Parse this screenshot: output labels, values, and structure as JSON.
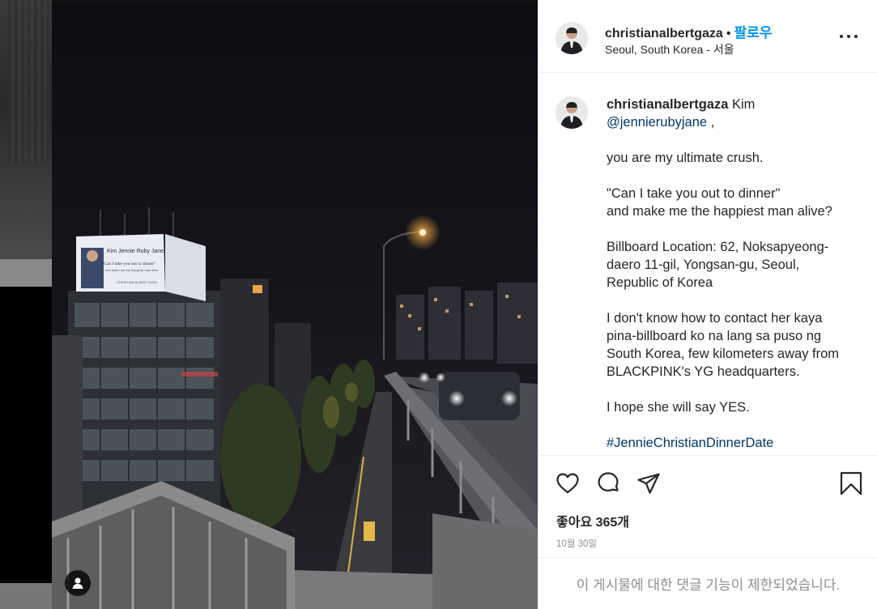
{
  "header": {
    "username": "christianalbertgaza",
    "separator": "•",
    "follow_label": "팔로우",
    "location": "Seoul, South Korea - 서울"
  },
  "caption": {
    "username": "christianalbertgaza",
    "line1_rest": " Kim",
    "mention": "@jennierubyjane",
    "mention_after": " ,",
    "text1": "you are my ultimate crush.",
    "quote1": "\"Can I take you out to dinner\"",
    "quote2": "and make me the happiest man alive?",
    "location1": "Billboard Location: 62, Noksapyeong-",
    "location2": "daero 11-gil, Yongsan-gu, Seoul,",
    "location3": "Republic of Korea",
    "para1": "I don't know how to contact her kaya",
    "para2": "pina-billboard ko na lang sa puso ng",
    "para3": "South Korea, few kilometers away from",
    "para4": "BLACKPINK's YG headquarters.",
    "hope": "I hope she will say YES.",
    "hashtag": "#JennieChristianDinnerDate"
  },
  "photo": {
    "billboard_title": "Kim Jennie Ruby Jane",
    "billboard_line": "\"Can I take you out to dinner\"",
    "billboard_sub": "and make me the happiest man alive",
    "billboard_sign": "CHRISTIAN ALBERT GAZA"
  },
  "actions": {
    "likes": "좋아요 365개",
    "date": "10월 30일",
    "icons": [
      "heart-icon",
      "comment-icon",
      "share-icon",
      "bookmark-icon"
    ]
  },
  "comments": {
    "disabled_text": "이 게시물에 대한 댓글 기능이 제한되었습니다."
  },
  "colors": {
    "accent": "#0095f6",
    "link": "#00376b",
    "muted": "#8e8e8e"
  }
}
